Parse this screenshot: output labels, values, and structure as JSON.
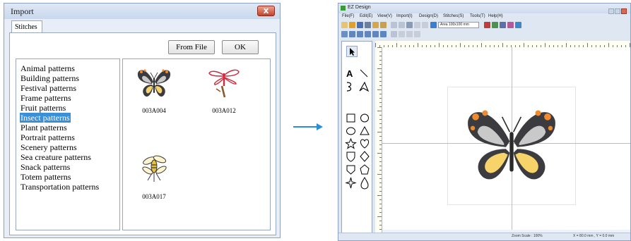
{
  "import_dialog": {
    "title": "Import",
    "close_label": "x",
    "tab_label": "Stitches",
    "from_file_label": "From File",
    "ok_label": "OK",
    "categories": [
      "Animal patterns",
      "Building patterns",
      "Festival patterns",
      "Frame patterns",
      "Fruit patterns",
      "Insect patterns",
      "Plant patterns",
      "Portrait patterns",
      "Scenery patterns",
      "Sea creature patterns",
      "Snack patterns",
      "Totem patterns",
      "Transportation patterns"
    ],
    "selected_category": "Insect patterns",
    "patterns": [
      {
        "code": "003A004",
        "icon": "butterfly-icon"
      },
      {
        "code": "003A012",
        "icon": "dragonfly-icon"
      },
      {
        "code": "003A017",
        "icon": "bee-icon"
      }
    ]
  },
  "ez_design": {
    "title": "EZ Design",
    "menus": [
      "File(F)",
      "Edit(E)",
      "View(V)",
      "Import(I)",
      "Design(D)",
      "Stitches(S)",
      "Tools(T)",
      "Help(H)"
    ],
    "hoop_size": "Area 100x100 mm",
    "status_zoom": "Zoom Scale : 100%",
    "status_coords": "X = 80.0 mm , Y = 0.0 mm",
    "canvas_pattern": "butterfly-icon"
  },
  "colors": {
    "accent_selection": "#3b8fd6",
    "arrow": "#2a8fd4",
    "butterfly_orange": "#f08a2a",
    "butterfly_yellow": "#f7d36a",
    "butterfly_dark": "#3b3b40"
  }
}
